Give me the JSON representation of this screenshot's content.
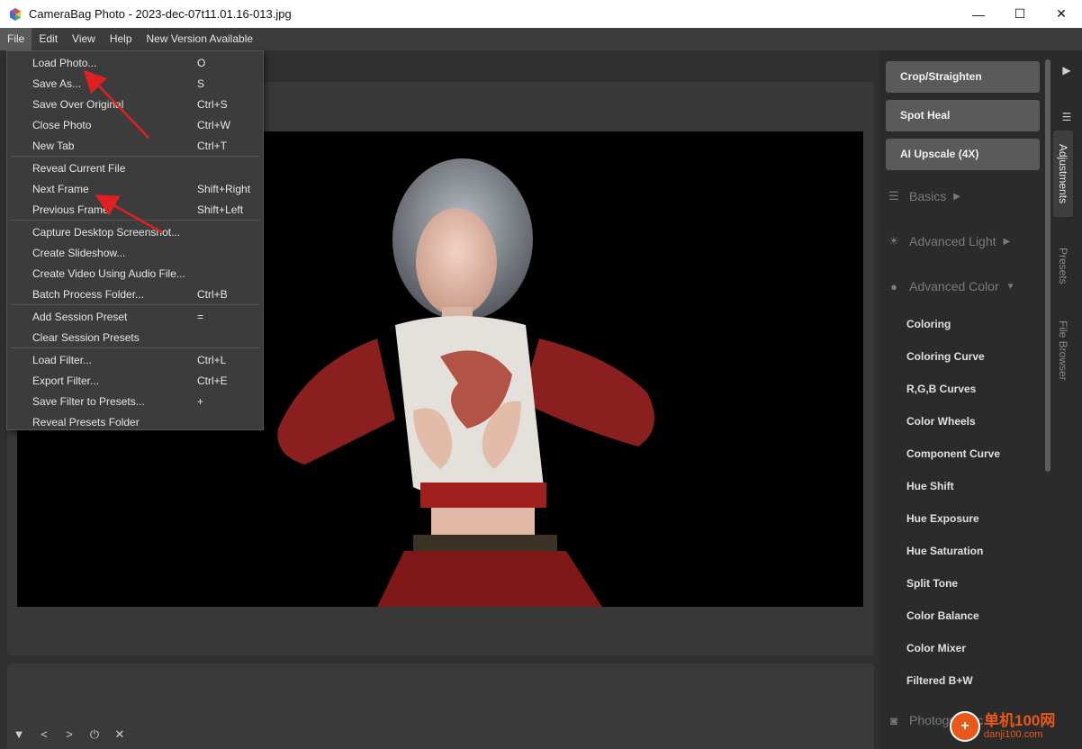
{
  "window": {
    "title": "CameraBag Photo - 2023-dec-07t11.01.16-013.jpg",
    "controls": {
      "minimize": "—",
      "maximize": "☐",
      "close": "✕"
    }
  },
  "menubar": {
    "items": [
      "File",
      "Edit",
      "View",
      "Help",
      "New Version Available"
    ]
  },
  "file_menu": {
    "items": [
      {
        "label": "Load Photo...",
        "shortcut": "O"
      },
      {
        "label": "Save As...",
        "shortcut": "S"
      },
      {
        "label": "Save Over Original",
        "shortcut": "Ctrl+S"
      },
      {
        "label": "Close Photo",
        "shortcut": "Ctrl+W"
      },
      {
        "label": "New Tab",
        "shortcut": "Ctrl+T"
      },
      {
        "label": "Reveal Current File",
        "shortcut": ""
      },
      {
        "label": "Next Frame",
        "shortcut": "Shift+Right"
      },
      {
        "label": "Previous Frame",
        "shortcut": "Shift+Left"
      },
      {
        "label": "Capture Desktop Screenshot...",
        "shortcut": ""
      },
      {
        "label": "Create Slideshow...",
        "shortcut": ""
      },
      {
        "label": "Create Video Using Audio File...",
        "shortcut": ""
      },
      {
        "label": "Batch Process Folder...",
        "shortcut": "Ctrl+B"
      },
      {
        "label": "Add Session Preset",
        "shortcut": "="
      },
      {
        "label": "Clear Session Presets",
        "shortcut": ""
      },
      {
        "label": "Load Filter...",
        "shortcut": "Ctrl+L"
      },
      {
        "label": "Export Filter...",
        "shortcut": "Ctrl+E"
      },
      {
        "label": "Save Filter to Presets...",
        "shortcut": "+"
      },
      {
        "label": "Reveal Presets Folder",
        "shortcut": ""
      }
    ]
  },
  "tools": {
    "crop": "Crop/Straighten",
    "spot_heal": "Spot Heal",
    "ai_upscale": "AI Upscale (4X)"
  },
  "sections": {
    "basics": "Basics",
    "advanced_light": "Advanced Light",
    "advanced_color": "Advanced Color",
    "photographic": "Photographic"
  },
  "advanced_color_items": [
    "Coloring",
    "Coloring Curve",
    "R,G,B Curves",
    "Color Wheels",
    "Component Curve",
    "Hue Shift",
    "Hue Exposure",
    "Hue Saturation",
    "Split Tone",
    "Color Balance",
    "Color Mixer",
    "Filtered B+W"
  ],
  "side_tabs": {
    "adjustments": "Adjustments",
    "presets": "Presets",
    "file_browser": "File Browser"
  },
  "bottom_toolbar": {
    "down": "▼",
    "prev": "<",
    "next": ">",
    "power": "⏻",
    "close": "✕"
  },
  "watermark": {
    "line1": "单机100网",
    "line2": "danji100.com"
  },
  "colors": {
    "menu_bg": "#3c3c3c",
    "tool_button": "#5a5a5a",
    "annotation_arrow": "#e02020"
  }
}
